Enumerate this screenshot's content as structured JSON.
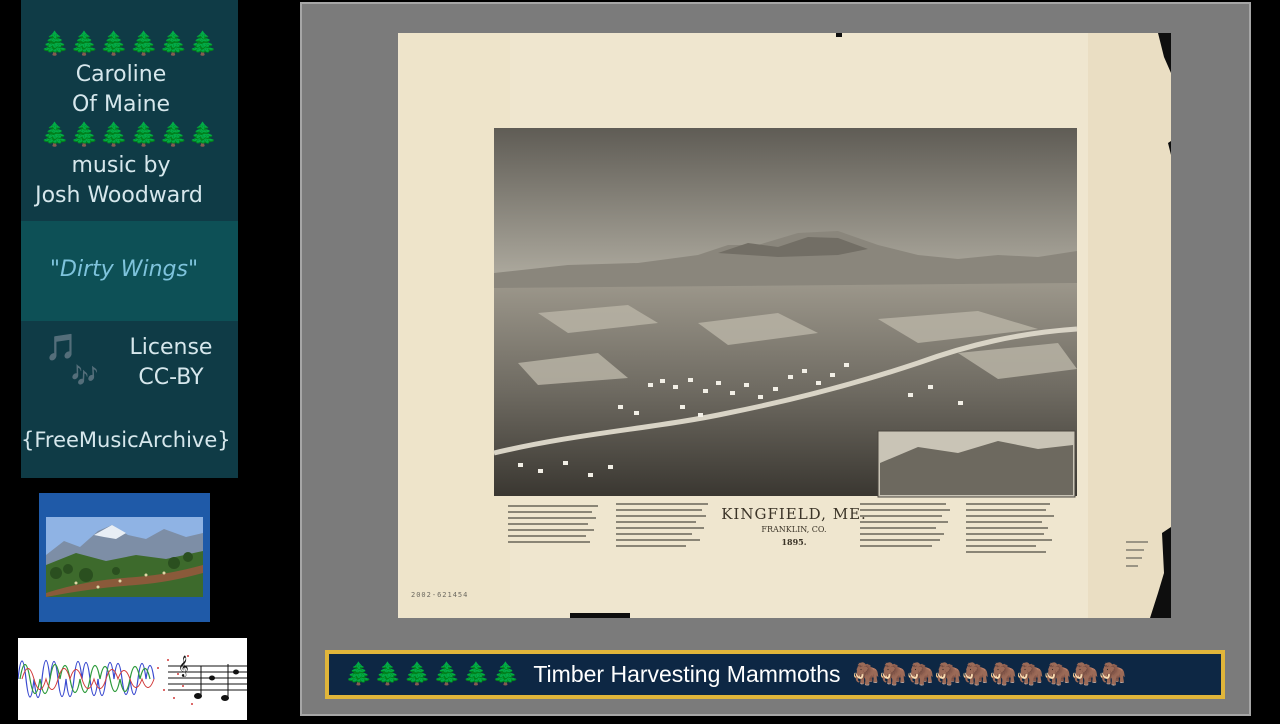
{
  "panel": {
    "trees": "🌲🌲🌲🌲🌲🌲",
    "artist_line1": "Caroline",
    "artist_line2": "Of Maine",
    "music_by_line1": "music by",
    "music_by_line2": "Josh Woodward",
    "track_title": "\"Dirty Wings\"",
    "note_icon_1": "🎵",
    "note_icon_2": "🎶",
    "license_line1": "License",
    "license_line2": "CC-BY",
    "source": "{FreeMusicArchive}"
  },
  "map": {
    "title": "KINGFIELD, ME.",
    "county": "FRANKLIN, CO.",
    "year": "1895.",
    "call_number": "2002-621454"
  },
  "banner": {
    "trees": "🌲🌲🌲🌲🌲🌲",
    "title": "Timber Harvesting Mammoths",
    "mammoths": "🦣🦣🦣🦣🦣🦣🦣🦣🦣🦣"
  },
  "colors": {
    "panel_bg": "#0f3b46",
    "track_box_bg": "#0d5056",
    "track_title": "#7ec3dc",
    "banner_border": "#e0b53a",
    "banner_bg": "#0d2744",
    "frame_bg": "#7b7b7b",
    "paper": "#efe6cf"
  }
}
